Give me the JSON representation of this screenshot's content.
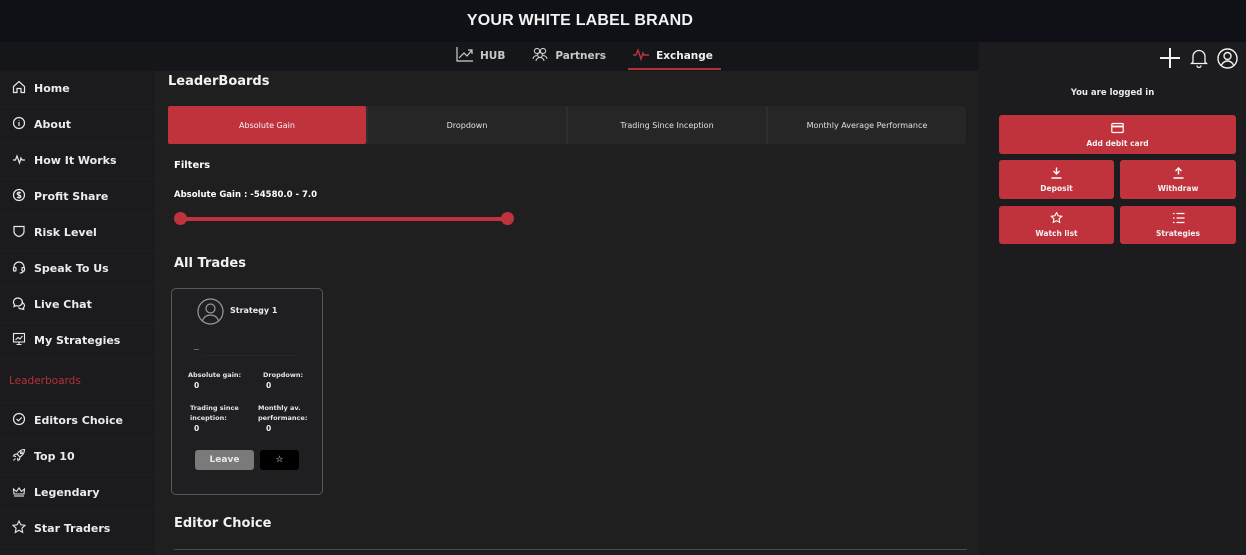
{
  "brand": "YOUR WHITE LABEL BRAND",
  "nav": {
    "tabs": [
      {
        "label": "HUB",
        "icon": "trend-up-icon",
        "active": false
      },
      {
        "label": "Partners",
        "icon": "users-icon",
        "active": false
      },
      {
        "label": "Exchange",
        "icon": "pulse-icon",
        "active": true
      }
    ]
  },
  "sidebar": {
    "items": [
      {
        "label": "Home",
        "icon": "home-icon"
      },
      {
        "label": "About",
        "icon": "info-icon"
      },
      {
        "label": "How It Works",
        "icon": "pulse-icon"
      },
      {
        "label": "Profit Share",
        "icon": "dollar-circle-icon"
      },
      {
        "label": "Risk Level",
        "icon": "shield-icon"
      },
      {
        "label": "Speak To Us",
        "icon": "headset-icon"
      },
      {
        "label": "Live Chat",
        "icon": "chat-icon"
      },
      {
        "label": "My Strategies",
        "icon": "presentation-icon"
      }
    ],
    "section_label": "Leaderboards",
    "section_color": "#b3303a",
    "leaderboard_items": [
      {
        "label": "Editors Choice",
        "icon": "check-circle-icon"
      },
      {
        "label": "Top 10",
        "icon": "rocket-icon"
      },
      {
        "label": "Legendary",
        "icon": "crown-icon"
      },
      {
        "label": "Star Traders",
        "icon": "star-icon"
      }
    ]
  },
  "main": {
    "title": "LeaderBoards",
    "tabs": [
      {
        "label": "Absolute Gain",
        "active": true
      },
      {
        "label": "Dropdown",
        "active": false
      },
      {
        "label": "Trading Since Inception",
        "active": false
      },
      {
        "label": "Monthly Average Performance",
        "active": false
      }
    ],
    "filters_label": "Filters",
    "range_label": "Absolute Gain : -54580.0 - 7.0",
    "range": {
      "min": -54580.0,
      "max": 7.0,
      "low_fraction": 0.0,
      "high_fraction": 1.0
    },
    "all_trades_title": "All Trades",
    "card": {
      "name": "Strategy 1",
      "stats": {
        "absolute_gain_label": "Absolute gain:",
        "absolute_gain_value": "0",
        "dropdown_label": "Dropdown:",
        "dropdown_value": "0",
        "trading_since_label_1": "Trading since",
        "trading_since_label_2": "inception:",
        "trading_since_value": "0",
        "monthly_label_1": "Monthly av.",
        "monthly_label_2": "performance:",
        "monthly_value": "0"
      },
      "leave_label": "Leave",
      "star_glyph": "☆"
    },
    "editor_choice_title": "Editor Choice"
  },
  "right": {
    "logged_in_text": "You are logged in",
    "buttons": {
      "add_card": "Add debit card",
      "deposit": "Deposit",
      "withdraw": "Withdraw",
      "watchlist": "Watch list",
      "strategies": "Strategies"
    }
  },
  "colors": {
    "accent": "#c0333d",
    "background": "#201f20",
    "topbar": "#101116"
  }
}
